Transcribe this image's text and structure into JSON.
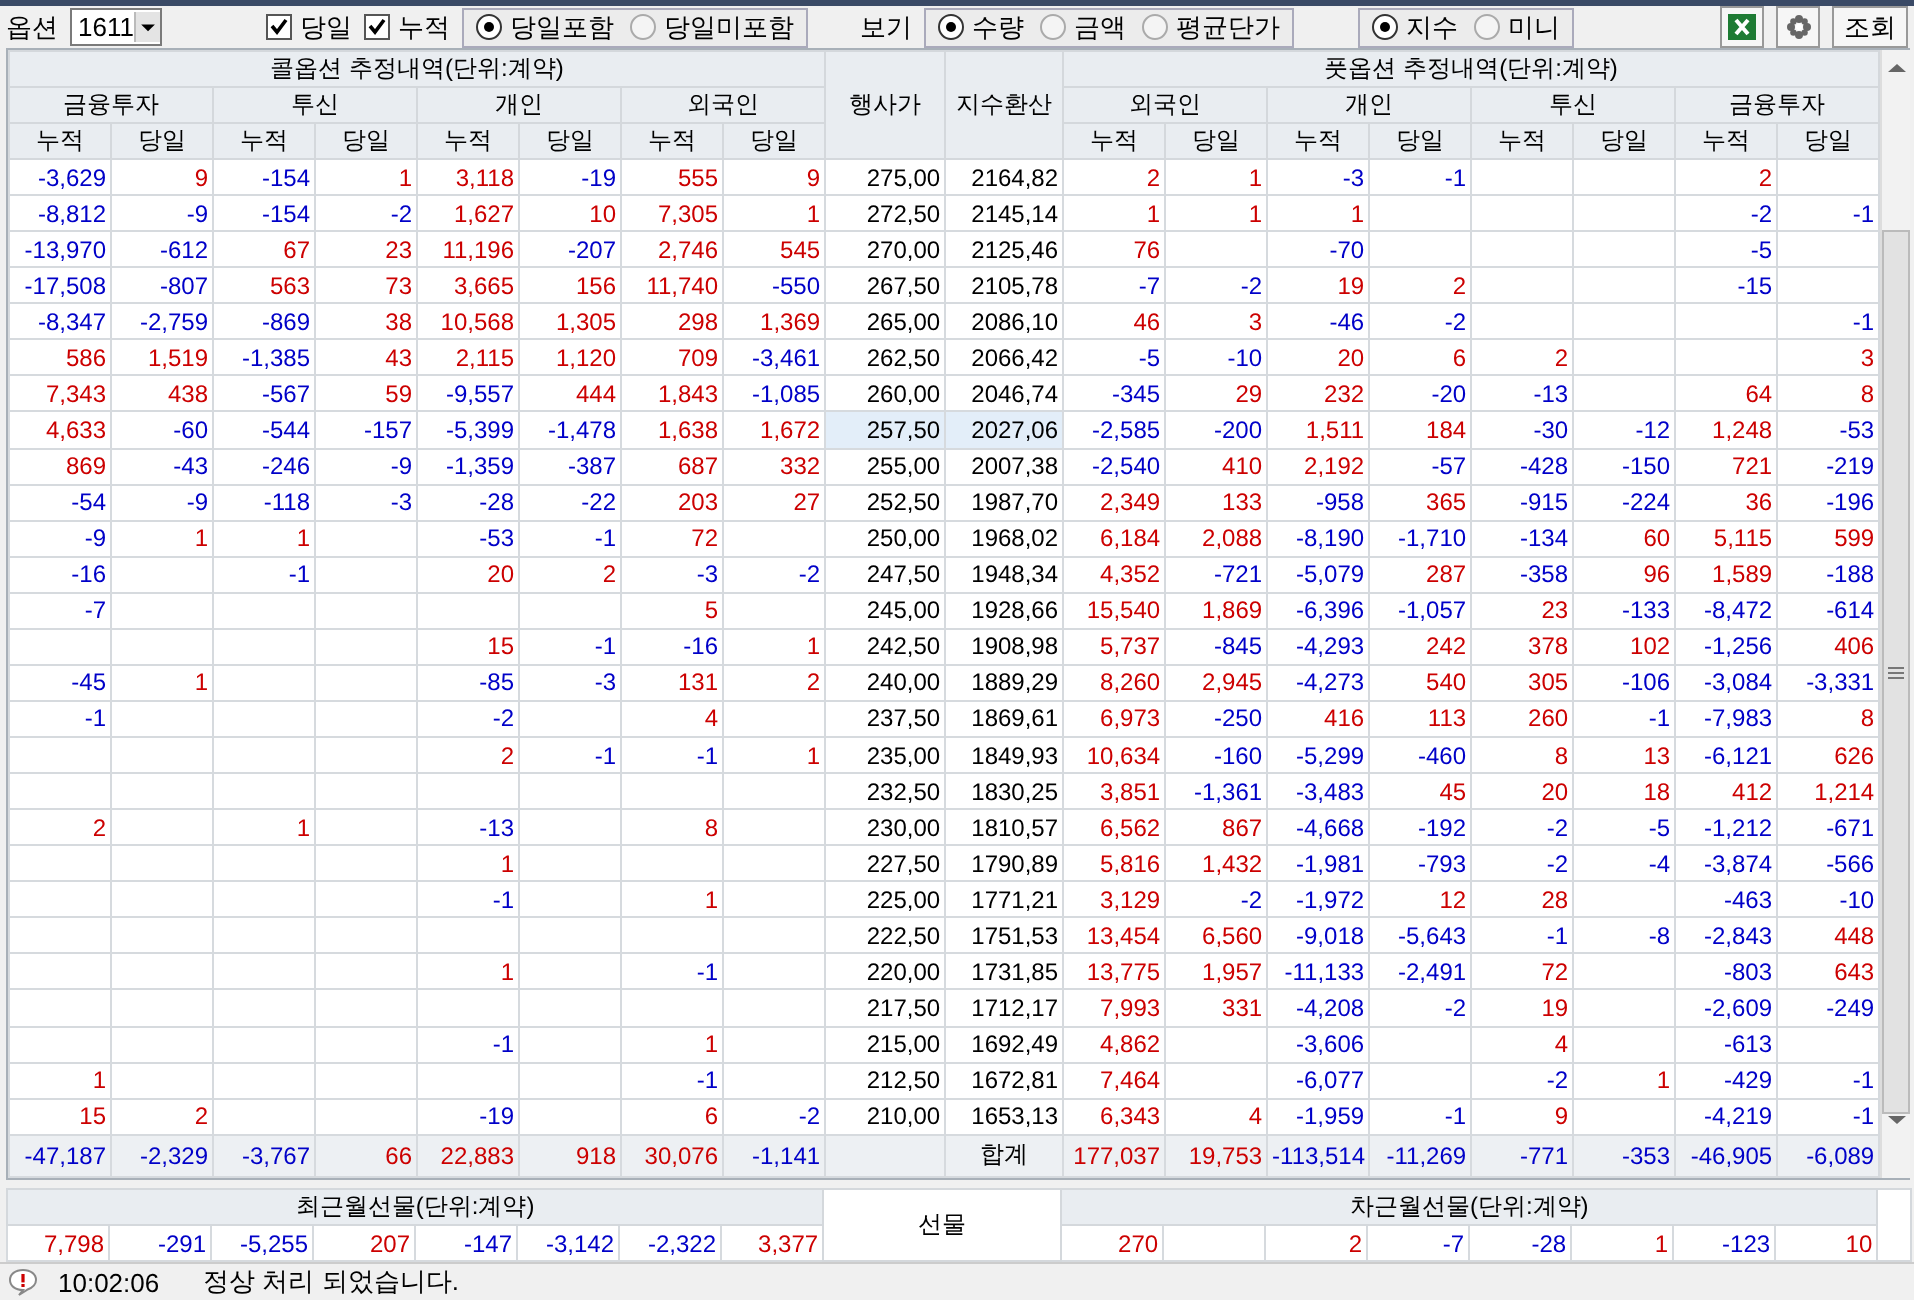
{
  "toolbar": {
    "option_label": "옵션",
    "option_select": "1611",
    "checkboxes": [
      {
        "label": "당일",
        "checked": true
      },
      {
        "label": "누적",
        "checked": true
      }
    ],
    "include_radios": [
      {
        "label": "당일포함",
        "selected": true
      },
      {
        "label": "당일미포함",
        "selected": false
      }
    ],
    "view_label": "보기",
    "view_radios": [
      {
        "label": "수량",
        "selected": true
      },
      {
        "label": "금액",
        "selected": false
      },
      {
        "label": "평균단가",
        "selected": false
      }
    ],
    "product_radios": [
      {
        "label": "지수",
        "selected": true
      },
      {
        "label": "미니",
        "selected": false
      }
    ],
    "query_button": "조회"
  },
  "table": {
    "call_title": "콜옵션 추정내역(단위:계약)",
    "put_title": "풋옵션 추정내역(단위:계약)",
    "strike_header": "행사가",
    "index_header": "지수환산",
    "call_groups": [
      {
        "name": "금융투자",
        "columns": [
          "누적",
          "당일"
        ]
      },
      {
        "name": "투신",
        "columns": [
          "누적",
          "당일"
        ]
      },
      {
        "name": "개인",
        "columns": [
          "누적",
          "당일"
        ]
      },
      {
        "name": "외국인",
        "columns": [
          "누적",
          "당일"
        ]
      }
    ],
    "put_groups": [
      {
        "name": "외국인",
        "columns": [
          "누적",
          "당일"
        ]
      },
      {
        "name": "개인",
        "columns": [
          "누적",
          "당일"
        ]
      },
      {
        "name": "투신",
        "columns": [
          "누적",
          "당일"
        ]
      },
      {
        "name": "금융투자",
        "columns": [
          "누적",
          "당일"
        ]
      }
    ],
    "rows": [
      {
        "strike": "275,00",
        "index": "2164,82",
        "atm": false,
        "call": {
          "fi_cum": "-3,629",
          "fi_day": "9",
          "trust_cum": "-154",
          "trust_day": "1",
          "indiv_cum": "3,118",
          "indiv_day": "-19",
          "foreign_cum": "555",
          "foreign_day": "9"
        },
        "put": {
          "foreign_cum": "2",
          "foreign_day": "1",
          "indiv_cum": "-3",
          "indiv_day": "-1",
          "fi_cum": "2"
        }
      },
      {
        "strike": "272,50",
        "index": "2145,14",
        "atm": false,
        "call": {
          "fi_cum": "-8,812",
          "fi_day": "-9",
          "trust_cum": "-154",
          "trust_day": "-2",
          "indiv_cum": "1,627",
          "indiv_day": "10",
          "foreign_cum": "7,305",
          "foreign_day": "1"
        },
        "put": {
          "foreign_cum": "1",
          "foreign_day": "1",
          "indiv_cum": "1",
          "fi_cum": "-2",
          "fi_day": "-1"
        }
      },
      {
        "strike": "270,00",
        "index": "2125,46",
        "atm": false,
        "call": {
          "fi_cum": "-13,970",
          "fi_day": "-612",
          "trust_cum": "67",
          "trust_day": "23",
          "indiv_cum": "11,196",
          "indiv_day": "-207",
          "foreign_cum": "2,746",
          "foreign_day": "545"
        },
        "put": {
          "foreign_cum": "76",
          "indiv_cum": "-70",
          "fi_cum": "-5"
        }
      },
      {
        "strike": "267,50",
        "index": "2105,78",
        "atm": false,
        "call": {
          "fi_cum": "-17,508",
          "fi_day": "-807",
          "trust_cum": "563",
          "trust_day": "73",
          "indiv_cum": "3,665",
          "indiv_day": "156",
          "foreign_cum": "11,740",
          "foreign_day": "-550"
        },
        "put": {
          "foreign_cum": "-7",
          "foreign_day": "-2",
          "indiv_cum": "19",
          "indiv_day": "2",
          "fi_cum": "-15"
        }
      },
      {
        "strike": "265,00",
        "index": "2086,10",
        "atm": false,
        "call": {
          "fi_cum": "-8,347",
          "fi_day": "-2,759",
          "trust_cum": "-869",
          "trust_day": "38",
          "indiv_cum": "10,568",
          "indiv_day": "1,305",
          "foreign_cum": "298",
          "foreign_day": "1,369"
        },
        "put": {
          "foreign_cum": "46",
          "foreign_day": "3",
          "indiv_cum": "-46",
          "indiv_day": "-2",
          "fi_day": "-1"
        }
      },
      {
        "strike": "262,50",
        "index": "2066,42",
        "atm": false,
        "call": {
          "fi_cum": "586",
          "fi_day": "1,519",
          "trust_cum": "-1,385",
          "trust_day": "43",
          "indiv_cum": "2,115",
          "indiv_day": "1,120",
          "foreign_cum": "709",
          "foreign_day": "-3,461"
        },
        "put": {
          "foreign_cum": "-5",
          "foreign_day": "-10",
          "indiv_cum": "20",
          "indiv_day": "6",
          "trust_cum": "2",
          "fi_day": "3"
        }
      },
      {
        "strike": "260,00",
        "index": "2046,74",
        "atm": false,
        "call": {
          "fi_cum": "7,343",
          "fi_day": "438",
          "trust_cum": "-567",
          "trust_day": "59",
          "indiv_cum": "-9,557",
          "indiv_day": "444",
          "foreign_cum": "1,843",
          "foreign_day": "-1,085"
        },
        "put": {
          "foreign_cum": "-345",
          "foreign_day": "29",
          "indiv_cum": "232",
          "indiv_day": "-20",
          "trust_cum": "-13",
          "fi_cum": "64",
          "fi_day": "8"
        }
      },
      {
        "strike": "257,50",
        "index": "2027,06",
        "atm": true,
        "call": {
          "fi_cum": "4,633",
          "fi_day": "-60",
          "trust_cum": "-544",
          "trust_day": "-157",
          "indiv_cum": "-5,399",
          "indiv_day": "-1,478",
          "foreign_cum": "1,638",
          "foreign_day": "1,672"
        },
        "put": {
          "foreign_cum": "-2,585",
          "foreign_day": "-200",
          "indiv_cum": "1,511",
          "indiv_day": "184",
          "trust_cum": "-30",
          "trust_day": "-12",
          "fi_cum": "1,248",
          "fi_day": "-53"
        }
      },
      {
        "strike": "255,00",
        "index": "2007,38",
        "atm": false,
        "call": {
          "fi_cum": "869",
          "fi_day": "-43",
          "trust_cum": "-246",
          "trust_day": "-9",
          "indiv_cum": "-1,359",
          "indiv_day": "-387",
          "foreign_cum": "687",
          "foreign_day": "332"
        },
        "put": {
          "foreign_cum": "-2,540",
          "foreign_day": "410",
          "indiv_cum": "2,192",
          "indiv_day": "-57",
          "trust_cum": "-428",
          "trust_day": "-150",
          "fi_cum": "721",
          "fi_day": "-219"
        }
      },
      {
        "strike": "252,50",
        "index": "1987,70",
        "atm": false,
        "call": {
          "fi_cum": "-54",
          "fi_day": "-9",
          "trust_cum": "-118",
          "trust_day": "-3",
          "indiv_cum": "-28",
          "indiv_day": "-22",
          "foreign_cum": "203",
          "foreign_day": "27"
        },
        "put": {
          "foreign_cum": "2,349",
          "foreign_day": "133",
          "indiv_cum": "-958",
          "indiv_day": "365",
          "trust_cum": "-915",
          "trust_day": "-224",
          "fi_cum": "36",
          "fi_day": "-196"
        }
      },
      {
        "strike": "250,00",
        "index": "1968,02",
        "atm": false,
        "call": {
          "fi_cum": "-9",
          "fi_day": "1",
          "trust_cum": "1",
          "indiv_cum": "-53",
          "indiv_day": "-1",
          "foreign_cum": "72"
        },
        "put": {
          "foreign_cum": "6,184",
          "foreign_day": "2,088",
          "indiv_cum": "-8,190",
          "indiv_day": "-1,710",
          "trust_cum": "-134",
          "trust_day": "60",
          "fi_cum": "5,115",
          "fi_day": "599"
        }
      },
      {
        "strike": "247,50",
        "index": "1948,34",
        "atm": false,
        "call": {
          "fi_cum": "-16",
          "trust_cum": "-1",
          "indiv_cum": "20",
          "indiv_day": "2",
          "foreign_cum": "-3",
          "foreign_day": "-2"
        },
        "put": {
          "foreign_cum": "4,352",
          "foreign_day": "-721",
          "indiv_cum": "-5,079",
          "indiv_day": "287",
          "trust_cum": "-358",
          "trust_day": "96",
          "fi_cum": "1,589",
          "fi_day": "-188"
        }
      },
      {
        "strike": "245,00",
        "index": "1928,66",
        "atm": false,
        "call": {
          "fi_cum": "-7",
          "foreign_cum": "5"
        },
        "put": {
          "foreign_cum": "15,540",
          "foreign_day": "1,869",
          "indiv_cum": "-6,396",
          "indiv_day": "-1,057",
          "trust_cum": "23",
          "trust_day": "-133",
          "fi_cum": "-8,472",
          "fi_day": "-614"
        }
      },
      {
        "strike": "242,50",
        "index": "1908,98",
        "atm": false,
        "call": {
          "indiv_cum": "15",
          "indiv_day": "-1",
          "foreign_cum": "-16",
          "foreign_day": "1"
        },
        "put": {
          "foreign_cum": "5,737",
          "foreign_day": "-845",
          "indiv_cum": "-4,293",
          "indiv_day": "242",
          "trust_cum": "378",
          "trust_day": "102",
          "fi_cum": "-1,256",
          "fi_day": "406"
        }
      },
      {
        "strike": "240,00",
        "index": "1889,29",
        "atm": false,
        "call": {
          "fi_cum": "-45",
          "fi_day": "1",
          "indiv_cum": "-85",
          "indiv_day": "-3",
          "foreign_cum": "131",
          "foreign_day": "2"
        },
        "put": {
          "foreign_cum": "8,260",
          "foreign_day": "2,945",
          "indiv_cum": "-4,273",
          "indiv_day": "540",
          "trust_cum": "305",
          "trust_day": "-106",
          "fi_cum": "-3,084",
          "fi_day": "-3,331"
        }
      },
      {
        "strike": "237,50",
        "index": "1869,61",
        "atm": false,
        "call": {
          "fi_cum": "-1",
          "indiv_cum": "-2",
          "foreign_cum": "4"
        },
        "put": {
          "foreign_cum": "6,973",
          "foreign_day": "-250",
          "indiv_cum": "416",
          "indiv_day": "113",
          "trust_cum": "260",
          "trust_day": "-1",
          "fi_cum": "-7,983",
          "fi_day": "8"
        }
      },
      {
        "strike": "235,00",
        "index": "1849,93",
        "atm": false,
        "call": {
          "indiv_cum": "2",
          "indiv_day": "-1",
          "foreign_cum": "-1",
          "foreign_day": "1"
        },
        "put": {
          "foreign_cum": "10,634",
          "foreign_day": "-160",
          "indiv_cum": "-5,299",
          "indiv_day": "-460",
          "trust_cum": "8",
          "trust_day": "13",
          "fi_cum": "-6,121",
          "fi_day": "626"
        }
      },
      {
        "strike": "232,50",
        "index": "1830,25",
        "atm": false,
        "call": {},
        "put": {
          "foreign_cum": "3,851",
          "foreign_day": "-1,361",
          "indiv_cum": "-3,483",
          "indiv_day": "45",
          "trust_cum": "20",
          "trust_day": "18",
          "fi_cum": "412",
          "fi_day": "1,214"
        }
      },
      {
        "strike": "230,00",
        "index": "1810,57",
        "atm": false,
        "call": {
          "fi_cum": "2",
          "trust_cum": "1",
          "indiv_cum": "-13",
          "foreign_cum": "8"
        },
        "put": {
          "foreign_cum": "6,562",
          "foreign_day": "867",
          "indiv_cum": "-4,668",
          "indiv_day": "-192",
          "trust_cum": "-2",
          "trust_day": "-5",
          "fi_cum": "-1,212",
          "fi_day": "-671"
        }
      },
      {
        "strike": "227,50",
        "index": "1790,89",
        "atm": false,
        "call": {
          "indiv_cum": "1"
        },
        "put": {
          "foreign_cum": "5,816",
          "foreign_day": "1,432",
          "indiv_cum": "-1,981",
          "indiv_day": "-793",
          "trust_cum": "-2",
          "trust_day": "-4",
          "fi_cum": "-3,874",
          "fi_day": "-566"
        }
      },
      {
        "strike": "225,00",
        "index": "1771,21",
        "atm": false,
        "call": {
          "indiv_cum": "-1",
          "foreign_cum": "1"
        },
        "put": {
          "foreign_cum": "3,129",
          "foreign_day": "-2",
          "indiv_cum": "-1,972",
          "indiv_day": "12",
          "trust_cum": "28",
          "fi_cum": "-463",
          "fi_day": "-10"
        }
      },
      {
        "strike": "222,50",
        "index": "1751,53",
        "atm": false,
        "call": {},
        "put": {
          "foreign_cum": "13,454",
          "foreign_day": "6,560",
          "indiv_cum": "-9,018",
          "indiv_day": "-5,643",
          "trust_cum": "-1",
          "trust_day": "-8",
          "fi_cum": "-2,843",
          "fi_day": "448"
        }
      },
      {
        "strike": "220,00",
        "index": "1731,85",
        "atm": false,
        "call": {
          "indiv_cum": "1",
          "foreign_cum": "-1"
        },
        "put": {
          "foreign_cum": "13,775",
          "foreign_day": "1,957",
          "indiv_cum": "-11,133",
          "indiv_day": "-2,491",
          "trust_cum": "72",
          "fi_cum": "-803",
          "fi_day": "643"
        }
      },
      {
        "strike": "217,50",
        "index": "1712,17",
        "atm": false,
        "call": {},
        "put": {
          "foreign_cum": "7,993",
          "foreign_day": "331",
          "indiv_cum": "-4,208",
          "indiv_day": "-2",
          "trust_cum": "19",
          "fi_cum": "-2,609",
          "fi_day": "-249"
        }
      },
      {
        "strike": "215,00",
        "index": "1692,49",
        "atm": false,
        "call": {
          "indiv_cum": "-1",
          "foreign_cum": "1"
        },
        "put": {
          "foreign_cum": "4,862",
          "indiv_cum": "-3,606",
          "trust_cum": "4",
          "fi_cum": "-613"
        }
      },
      {
        "strike": "212,50",
        "index": "1672,81",
        "atm": false,
        "call": {
          "fi_cum": "1",
          "foreign_cum": "-1"
        },
        "put": {
          "foreign_cum": "7,464",
          "indiv_cum": "-6,077",
          "trust_cum": "-2",
          "trust_day": "1",
          "fi_cum": "-429",
          "fi_day": "-1"
        }
      },
      {
        "strike": "210,00",
        "index": "1653,13",
        "atm": false,
        "call": {
          "fi_cum": "15",
          "fi_day": "2",
          "indiv_cum": "-19",
          "foreign_cum": "6",
          "foreign_day": "-2"
        },
        "put": {
          "foreign_cum": "6,343",
          "foreign_day": "4",
          "indiv_cum": "-1,959",
          "indiv_day": "-1",
          "trust_cum": "9",
          "fi_cum": "-4,219",
          "fi_day": "-1"
        }
      }
    ],
    "totals": {
      "label": "합계",
      "call": [
        "-47,187",
        "-2,329",
        "-3,767",
        "66",
        "22,883",
        "918",
        "30,076",
        "-1,141"
      ],
      "put": [
        "177,037",
        "19,753",
        "-113,514",
        "-11,269",
        "-771",
        "-353",
        "-46,905",
        "-6,089"
      ]
    }
  },
  "futures": {
    "near_title": "최근월선물(단위:계약)",
    "label": "선물",
    "next_title": "차근월선물(단위:계약)",
    "near": {
      "fi_cum": "7,798",
      "fi_day": "-291",
      "trust_cum": "-5,255",
      "trust_day": "207",
      "indiv_cum": "-147",
      "indiv_day": "-3,142",
      "foreign_cum": "-2,322",
      "foreign_day": "3,377"
    },
    "next": {
      "foreign_cum": "270",
      "indiv_cum": "2",
      "indiv_day": "-7",
      "trust_cum": "-28",
      "trust_day": "1",
      "fi_cum": "-123",
      "fi_day": "10"
    }
  },
  "status_bar": {
    "time": "10:02:06",
    "message": "정상 처리 되었습니다."
  }
}
